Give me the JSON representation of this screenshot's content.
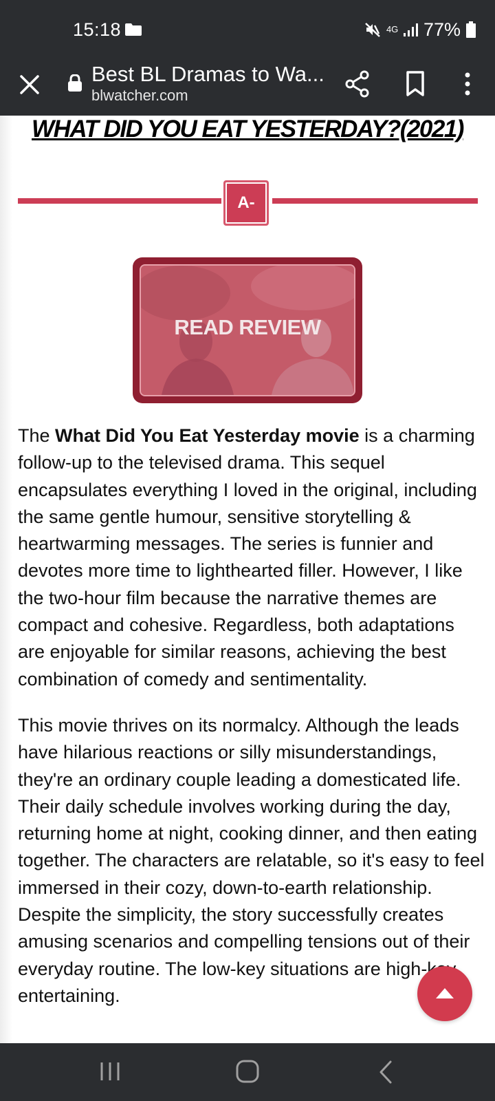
{
  "status_bar": {
    "time": "15:18",
    "network": "4G",
    "battery": "77%"
  },
  "browser": {
    "tab_title": "Best BL Dramas to Wa...",
    "url": "blwatcher.com"
  },
  "article": {
    "heading": "WHAT DID YOU EAT YESTERDAY?(2021)",
    "grade": "A-",
    "review_button_label": "READ REVIEW",
    "p1_intro": "The ",
    "p1_bold": "What Did You Eat Yesterday movie",
    "p1_rest": " is a charming follow-up to the televised drama. This sequel encapsulates everything I loved in the original, including the same gentle humour, sensitive storytelling & heartwarming messages. The series is funnier and devotes more time to lighthearted filler. However, I like the two-hour film because the narrative themes are compact and cohesive. Regardless, both adaptations are enjoyable for similar reasons, achieving the best combination of comedy and sentimentality.",
    "p2": "This movie thrives on its normalcy. Although the leads have hilarious reactions or silly misunderstandings, they're an ordinary couple leading a domesticated life. Their daily schedule involves working during the day, returning home at night, cooking dinner, and then eating together. The characters are relatable, so it's easy to feel immersed in their cozy, down-to-earth relationship. Despite the simplicity, the story successfully creates amusing scenarios and compelling tensions out of their everyday routine. The low-key situations are high-key entertaining."
  },
  "colors": {
    "accent": "#cc3d55",
    "bar_background": "#2b2d30"
  },
  "icons": {
    "close": "close-icon",
    "lock": "lock-icon",
    "share": "share-icon",
    "bookmark": "bookmark-icon",
    "menu": "more-vert-icon",
    "scroll_top": "arrow-up-icon",
    "nav_recent": "recent-apps-icon",
    "nav_home": "home-icon",
    "nav_back": "back-icon"
  }
}
